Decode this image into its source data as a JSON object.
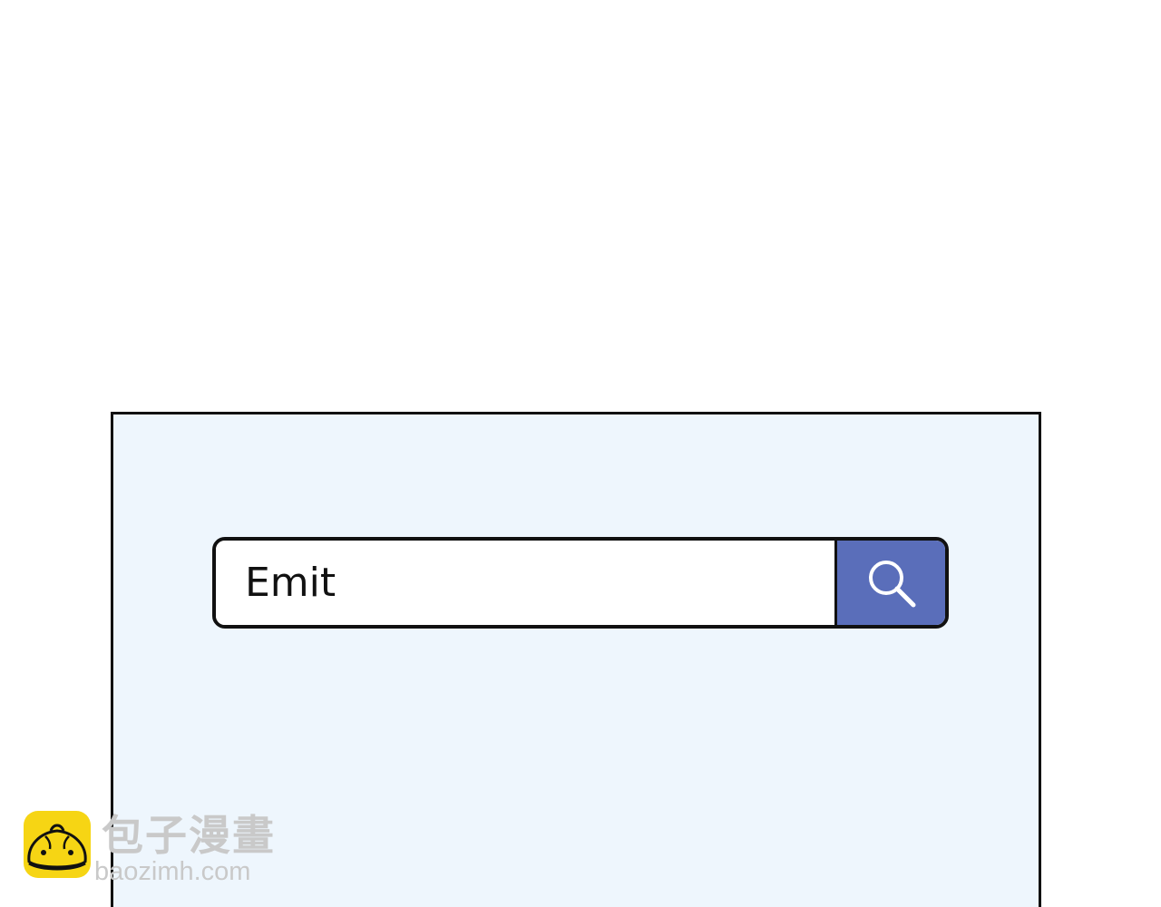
{
  "search": {
    "value": "Emit",
    "button_icon": "search-icon"
  },
  "watermark": {
    "title": "包子漫畫",
    "url": "baozimh.com",
    "logo_icon": "bun-mascot-icon"
  },
  "colors": {
    "panel_background": "#eef6fd",
    "search_button": "#5a6eba",
    "border": "#111111",
    "watermark_logo": "#f6d514",
    "watermark_text": "#c9c9c9"
  }
}
